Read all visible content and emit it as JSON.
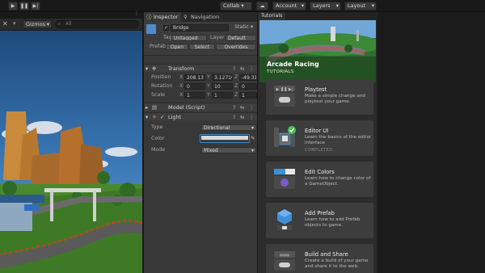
{
  "toolbar": {
    "play_icon": "play-icon",
    "pause_icon": "pause-icon",
    "step_icon": "step-icon",
    "collab_label": "Collab",
    "cloud_icon": "cloud-icon",
    "account_label": "Account",
    "layers_label": "Layers",
    "layout_label": "Layout"
  },
  "scene": {
    "gizmos_label": "Gizmos",
    "search_placeholder": "All"
  },
  "inspector": {
    "tabs": [
      "Inspector",
      "Navigation"
    ],
    "object_name": "Bridge",
    "static_label": "Static",
    "tag_label": "Tag",
    "tag_value": "Untagged",
    "layer_label": "Layer",
    "layer_value": "Default",
    "prefab_label": "Prefab",
    "prefab_open": "Open",
    "prefab_select": "Select",
    "prefab_overrides": "Overrides",
    "transform_label": "Transform",
    "position_label": "Position",
    "position": {
      "x": "208.13",
      "y": "3.12716",
      "z": "-49.31"
    },
    "rotation_label": "Rotation",
    "rotation": {
      "x": "0",
      "y": "10",
      "z": "0"
    },
    "scale_label": "Scale",
    "scale": {
      "x": "1",
      "y": "1",
      "z": "1"
    },
    "model_script_label": "Model (Script)",
    "light_label": "Light",
    "type_label": "Type",
    "type_value": "Directional",
    "color_label": "Color",
    "mode_label": "Mode",
    "mode_value": "Mixed"
  },
  "tutorials": {
    "tab_label": "Tutorials",
    "hero_title": "Arcade Racing",
    "hero_subtitle": "TUTORIALS",
    "cards": [
      {
        "title": "Playtest",
        "desc": "Make a simple change and playtest your game.",
        "status": ""
      },
      {
        "title": "Editor UI",
        "desc": "Learn the basics of the editor interface",
        "status": "COMPLETED"
      },
      {
        "title": "Edit Colors",
        "desc": "Learn how to change color of a GameObject.",
        "status": ""
      },
      {
        "title": "Add Prefab",
        "desc": "Learn how to add Prefab objects to game.",
        "status": ""
      },
      {
        "title": "Build and Share",
        "desc": "Create a build of your game and share it to the web.",
        "status": ""
      }
    ]
  },
  "colors": {
    "accent_blue": "#3d8fd6",
    "completed_green": "#4bbf5a",
    "panel_bg": "#383838"
  }
}
